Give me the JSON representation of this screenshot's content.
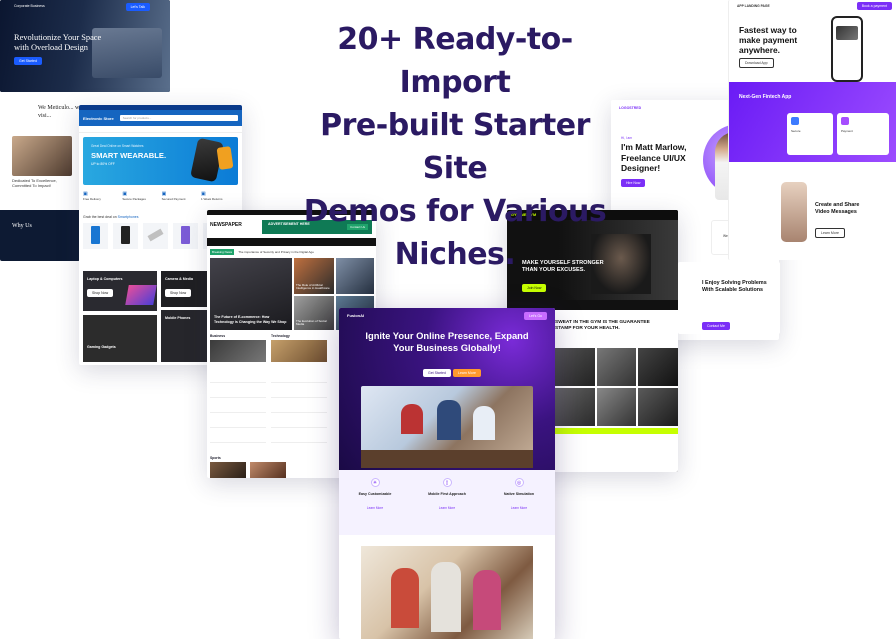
{
  "headline": {
    "line1": "20+ Ready-to-Import",
    "line2": "Pre-built Starter Site",
    "line3": "Demos for Various",
    "line4": "Niches."
  },
  "corporate": {
    "brand": "Corporate Business",
    "hero_line1": "Revolutionize Your Space",
    "hero_line2": "with Overload Design",
    "hero_button": "Get Started",
    "section_title": "We Meticulo... with a visi...",
    "side_text": "Dedicated To Excellence, Committed To Impact!",
    "why": "Why Us",
    "nav_cta": "Let's Talk"
  },
  "electronic": {
    "brand": "Electronic Store",
    "search_placeholder": "Search for products...",
    "promo_small": "Great Deal Online on Smart Watches",
    "promo_big1": "SMART WEARABLE.",
    "promo_sub": "UP to 80% OFF",
    "features": [
      "Free Delivery",
      "Secure Packages",
      "Secured Payment",
      "1 Week Returns"
    ],
    "deals_title": "Grab the best deal on",
    "deals_accent": "Smartphones",
    "cat1": "Laptop & Computers",
    "cat2": "Camera & Media",
    "cat3": "Mobile Phones",
    "cat4": "Gaming Gadgets",
    "shop": "Shop Now"
  },
  "newspaper": {
    "brand": "NEWSPAPER",
    "ad_title": "ADVERTISEMENT HERE",
    "ad_button": "Contact Us",
    "breaking": "Breaking News",
    "ticker": "The importance of Security and Privacy in the Digital Age",
    "lead_title": "The Future of E-commerce: How Technology is Changing the Way We Shop",
    "side1": "The Role of Artificial Intelligence in Healthcare",
    "side2": "The Evolution of Social Media",
    "sect1": "Business",
    "sect2": "Technology",
    "sect3": "Sports"
  },
  "gym": {
    "brand": "GYM ME GYM",
    "hero1": "MAKE YOURSELF STRONGER",
    "hero2": "THAN YOUR EXCUSES.",
    "cta": "Join Now",
    "sweat1": "SWEAT IN THE GYM IS THE GUARANTEE",
    "sweat2": "STAMP FOR YOUR HEALTH."
  },
  "freelancer": {
    "brand": "LOGOSTRED",
    "intro": "Hi, I am",
    "name1": "I'm Matt Marlow,",
    "name2": "Freelance UI/UX",
    "name3": "Designer!",
    "cta": "Hire Now",
    "problems1": "I Enjoy Solving Problems",
    "problems2": "With Scalable Solutions",
    "cta2": "Contact Me",
    "service": "Web Application",
    "nav_cta": "Hire Me"
  },
  "fintech": {
    "brand": "APP LANDING PAGE",
    "hero1": "Fastest way to",
    "hero2": "make payment",
    "hero3": "anywhere.",
    "store_btn": "Download App",
    "nav_cta": "Book a payment",
    "band_title": "Next-Gen Fintech App",
    "card1": "Secure",
    "card2": "Payment",
    "video1": "Create and Share",
    "video2": "Video Messages",
    "video_btn": "Learn More"
  },
  "fusion": {
    "brand": "FusionAI",
    "hero1": "Ignite Your Online Presence, Expand",
    "hero2": "Your Business Globally!",
    "btn1": "Get Started",
    "btn2": "Learn More",
    "features": [
      {
        "title": "Easy Customizable",
        "link": "Learn More"
      },
      {
        "title": "Mobile First Approach",
        "link": "Learn More"
      },
      {
        "title": "Native Simulation",
        "link": "Learn More"
      }
    ],
    "nav_cta": "Let's Go"
  },
  "colors": {
    "headline": "#2b1a63",
    "purple": "#7b2ff7",
    "blue": "#1565c0",
    "gym_lime": "#c6ff00",
    "news_green": "#1fa36b"
  }
}
